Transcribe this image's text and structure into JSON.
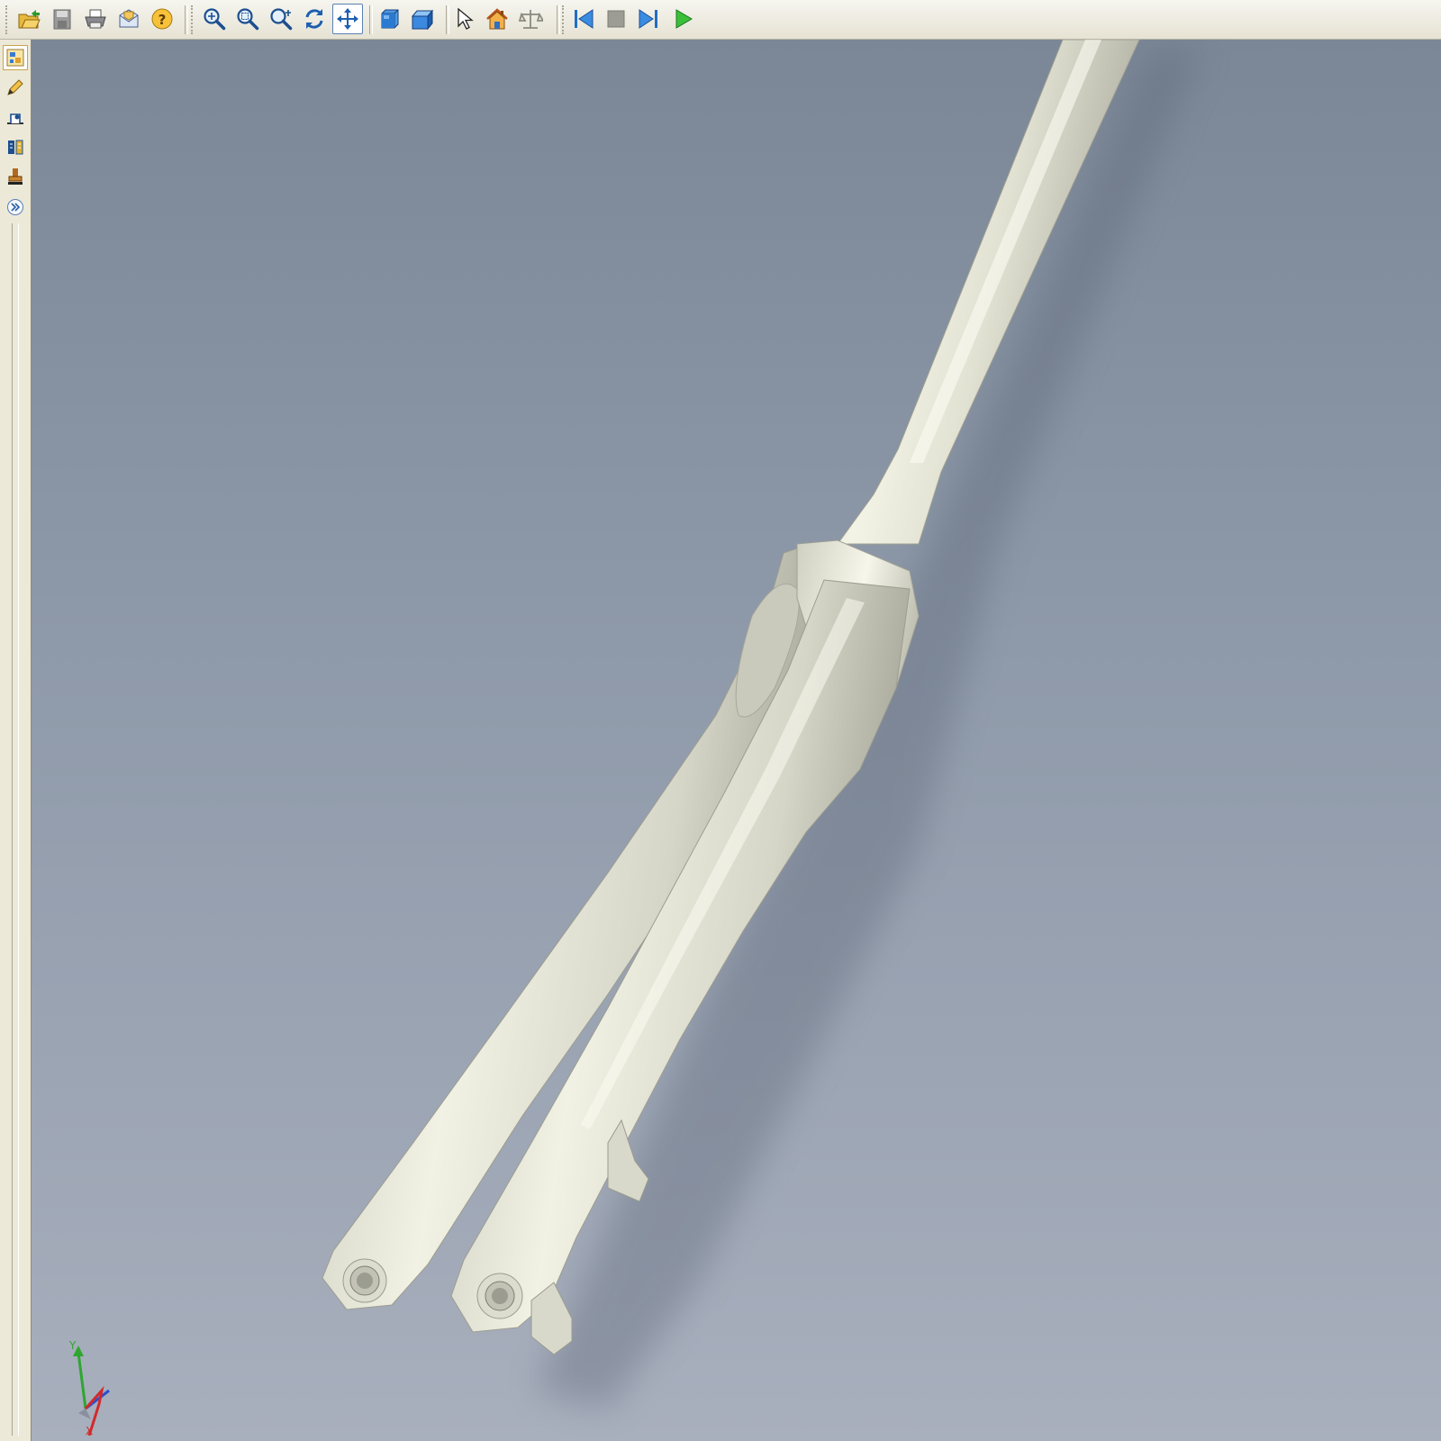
{
  "toolbar": {
    "groups": [
      [
        "open-icon",
        "save-icon",
        "print-icon",
        "email-icon",
        "help-icon"
      ],
      [
        "zoom-icon",
        "zoom-window-icon",
        "zoom-all-icon",
        "rotate-icon",
        "pan-icon"
      ],
      [
        "shaded-view-icon",
        "iso-view-icon"
      ],
      [
        "select-icon",
        "home-view-icon",
        "measure-icon"
      ],
      [
        "previous-icon",
        "stop-icon",
        "next-icon",
        "play-icon"
      ]
    ],
    "active_tool": "pan-icon"
  },
  "sidebar": {
    "items": [
      "model-browser-icon",
      "markup-pencil-icon",
      "measure-tool-icon",
      "section-icon",
      "stamp-icon",
      "expand-icon"
    ],
    "active_item": "model-browser-icon"
  },
  "viewport": {
    "model": "bicycle-fork",
    "background_top": "#7b8797",
    "background_bottom": "#a8afbd",
    "model_color": "#dcdccf"
  },
  "triad": {
    "y_label": "Y",
    "x_label": "X"
  }
}
